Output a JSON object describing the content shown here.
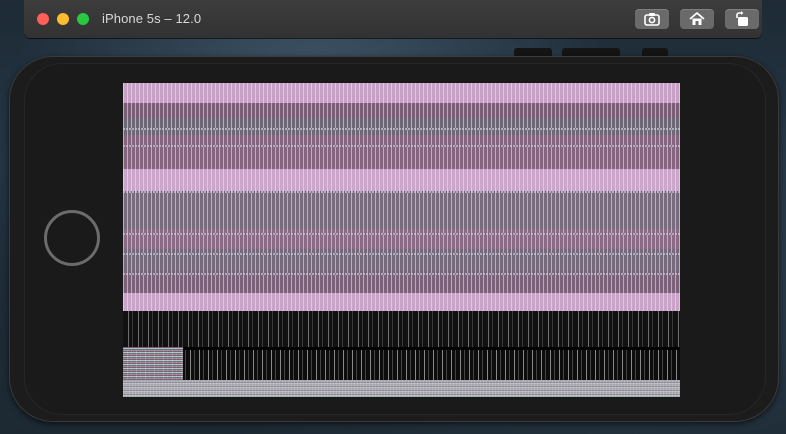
{
  "window": {
    "title": "iPhone 5s – 12.0",
    "traffic_lights": {
      "close_color": "#fe5f57",
      "minimize_color": "#febc2e",
      "zoom_color": "#28c840"
    },
    "toolbar": [
      {
        "name": "screenshot",
        "icon": "camera-icon"
      },
      {
        "name": "home",
        "icon": "home-icon"
      },
      {
        "name": "rotate",
        "icon": "rotate-icon"
      }
    ]
  },
  "device": {
    "model": "iPhone 5s",
    "orientation": "landscape",
    "screen_state": "glitched-render"
  },
  "colors": {
    "stripe_pink": "#c7a1c6",
    "stripe_mauve": "#7a5e78",
    "body": "#1c1c1c"
  }
}
